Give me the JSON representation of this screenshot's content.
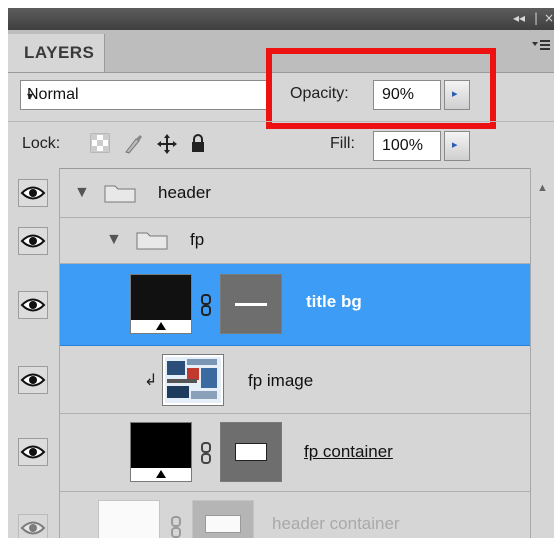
{
  "panel": {
    "title_controls": [
      "◂◂",
      "|",
      "×"
    ],
    "tab_label": "LAYERS",
    "menu_icon": "panel-menu-icon"
  },
  "blend": {
    "mode": "Normal",
    "arrow": "▾"
  },
  "opacity": {
    "label": "Opacity:",
    "value": "90%"
  },
  "lock": {
    "label": "Lock:"
  },
  "fill": {
    "label": "Fill:",
    "value": "100%"
  },
  "step_arrow": "▸",
  "layers": [
    {
      "name": "header",
      "type": "group",
      "expanded": true,
      "selected": false,
      "visible": true
    },
    {
      "name": "fp",
      "type": "group",
      "expanded": true,
      "selected": false,
      "visible": true
    },
    {
      "name": "title bg",
      "type": "shape",
      "selected": true,
      "visible": true
    },
    {
      "name": "fp image",
      "type": "clipped-image",
      "selected": false,
      "visible": true
    },
    {
      "name": "fp container",
      "type": "shape",
      "selected": false,
      "visible": true
    },
    {
      "name": "header container",
      "type": "shape",
      "selected": false,
      "visible": false
    }
  ],
  "tree": {
    "expanded_glyph": "▼",
    "clip_glyph": "↲"
  },
  "colors": {
    "selection": "#3d9cf5",
    "highlight_box": "#ee1111",
    "panel": "#d6d6d6"
  }
}
